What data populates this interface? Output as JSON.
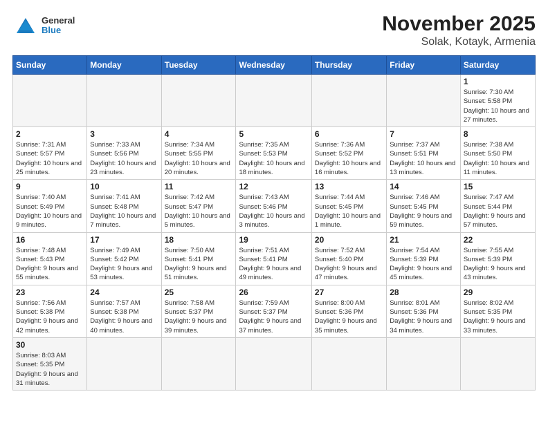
{
  "header": {
    "title": "November 2025",
    "subtitle": "Solak, Kotayk, Armenia",
    "logo_general": "General",
    "logo_blue": "Blue"
  },
  "weekdays": [
    "Sunday",
    "Monday",
    "Tuesday",
    "Wednesday",
    "Thursday",
    "Friday",
    "Saturday"
  ],
  "days": {
    "1": "Sunrise: 7:30 AM\nSunset: 5:58 PM\nDaylight: 10 hours and 27 minutes.",
    "2": "Sunrise: 7:31 AM\nSunset: 5:57 PM\nDaylight: 10 hours and 25 minutes.",
    "3": "Sunrise: 7:33 AM\nSunset: 5:56 PM\nDaylight: 10 hours and 23 minutes.",
    "4": "Sunrise: 7:34 AM\nSunset: 5:55 PM\nDaylight: 10 hours and 20 minutes.",
    "5": "Sunrise: 7:35 AM\nSunset: 5:53 PM\nDaylight: 10 hours and 18 minutes.",
    "6": "Sunrise: 7:36 AM\nSunset: 5:52 PM\nDaylight: 10 hours and 16 minutes.",
    "7": "Sunrise: 7:37 AM\nSunset: 5:51 PM\nDaylight: 10 hours and 13 minutes.",
    "8": "Sunrise: 7:38 AM\nSunset: 5:50 PM\nDaylight: 10 hours and 11 minutes.",
    "9": "Sunrise: 7:40 AM\nSunset: 5:49 PM\nDaylight: 10 hours and 9 minutes.",
    "10": "Sunrise: 7:41 AM\nSunset: 5:48 PM\nDaylight: 10 hours and 7 minutes.",
    "11": "Sunrise: 7:42 AM\nSunset: 5:47 PM\nDaylight: 10 hours and 5 minutes.",
    "12": "Sunrise: 7:43 AM\nSunset: 5:46 PM\nDaylight: 10 hours and 3 minutes.",
    "13": "Sunrise: 7:44 AM\nSunset: 5:45 PM\nDaylight: 10 hours and 1 minute.",
    "14": "Sunrise: 7:46 AM\nSunset: 5:45 PM\nDaylight: 9 hours and 59 minutes.",
    "15": "Sunrise: 7:47 AM\nSunset: 5:44 PM\nDaylight: 9 hours and 57 minutes.",
    "16": "Sunrise: 7:48 AM\nSunset: 5:43 PM\nDaylight: 9 hours and 55 minutes.",
    "17": "Sunrise: 7:49 AM\nSunset: 5:42 PM\nDaylight: 9 hours and 53 minutes.",
    "18": "Sunrise: 7:50 AM\nSunset: 5:41 PM\nDaylight: 9 hours and 51 minutes.",
    "19": "Sunrise: 7:51 AM\nSunset: 5:41 PM\nDaylight: 9 hours and 49 minutes.",
    "20": "Sunrise: 7:52 AM\nSunset: 5:40 PM\nDaylight: 9 hours and 47 minutes.",
    "21": "Sunrise: 7:54 AM\nSunset: 5:39 PM\nDaylight: 9 hours and 45 minutes.",
    "22": "Sunrise: 7:55 AM\nSunset: 5:39 PM\nDaylight: 9 hours and 43 minutes.",
    "23": "Sunrise: 7:56 AM\nSunset: 5:38 PM\nDaylight: 9 hours and 42 minutes.",
    "24": "Sunrise: 7:57 AM\nSunset: 5:38 PM\nDaylight: 9 hours and 40 minutes.",
    "25": "Sunrise: 7:58 AM\nSunset: 5:37 PM\nDaylight: 9 hours and 39 minutes.",
    "26": "Sunrise: 7:59 AM\nSunset: 5:37 PM\nDaylight: 9 hours and 37 minutes.",
    "27": "Sunrise: 8:00 AM\nSunset: 5:36 PM\nDaylight: 9 hours and 35 minutes.",
    "28": "Sunrise: 8:01 AM\nSunset: 5:36 PM\nDaylight: 9 hours and 34 minutes.",
    "29": "Sunrise: 8:02 AM\nSunset: 5:35 PM\nDaylight: 9 hours and 33 minutes.",
    "30": "Sunrise: 8:03 AM\nSunset: 5:35 PM\nDaylight: 9 hours and 31 minutes."
  }
}
